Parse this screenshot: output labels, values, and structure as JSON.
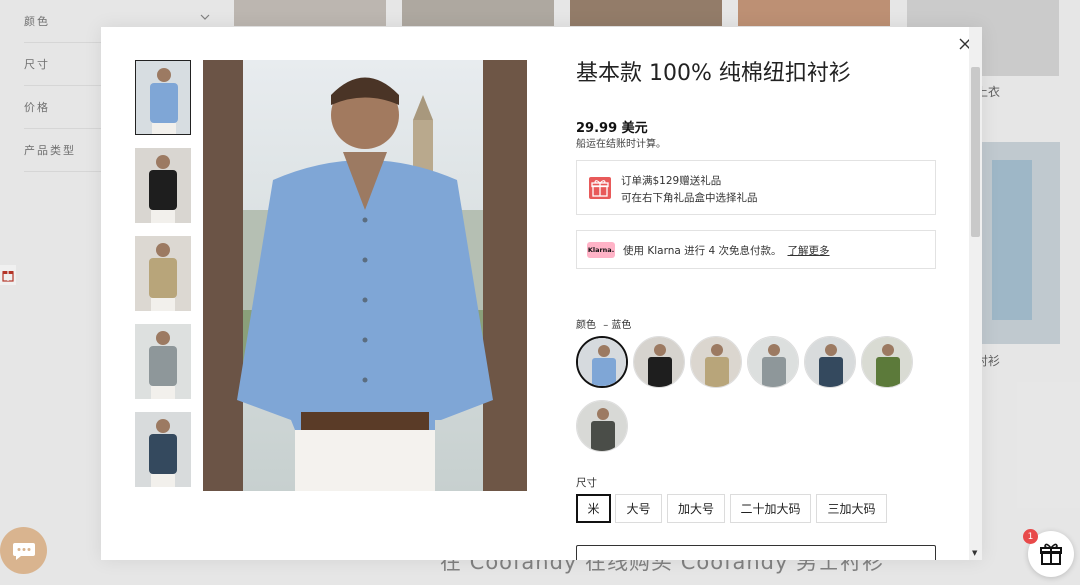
{
  "filters": [
    "颜色",
    "尺寸",
    "价格",
    "产品类型"
  ],
  "background": {
    "caption_right_top": "上衣",
    "caption_right_mid": "衬衫",
    "bottom_text": "在 Coofandy 在线购买 Coofandy 男士衬衫"
  },
  "product": {
    "title": "基本款 100% 纯棉纽扣衬衫",
    "price": "29.99 美元",
    "shipping_note": "船运在结账时计算。",
    "promo_line1": "订单满$129赠送礼品",
    "promo_line2": "可在右下角礼品盒中选择礼品",
    "klarna_badge": "Klarna.",
    "klarna_text": "使用 Klarna 进行 4 次免息付款。",
    "klarna_link": "了解更多",
    "color_label": "颜色",
    "color_selected": "– 蓝色",
    "size_label": "尺寸",
    "sizes": [
      "米",
      "大号",
      "加大号",
      "二十加大码",
      "三加大码"
    ],
    "selected_size": "米"
  },
  "colors": {
    "accent": "#e85a5a",
    "klarna_pink": "#ffb3c7",
    "chat": "#d9b48f"
  },
  "swatch_colors": [
    "#7fa6d6",
    "#1e1e1e",
    "#b8a57a",
    "#8e979a",
    "#34495e",
    "#5c7a3a",
    "#4a4d48"
  ],
  "gift_count": "1"
}
